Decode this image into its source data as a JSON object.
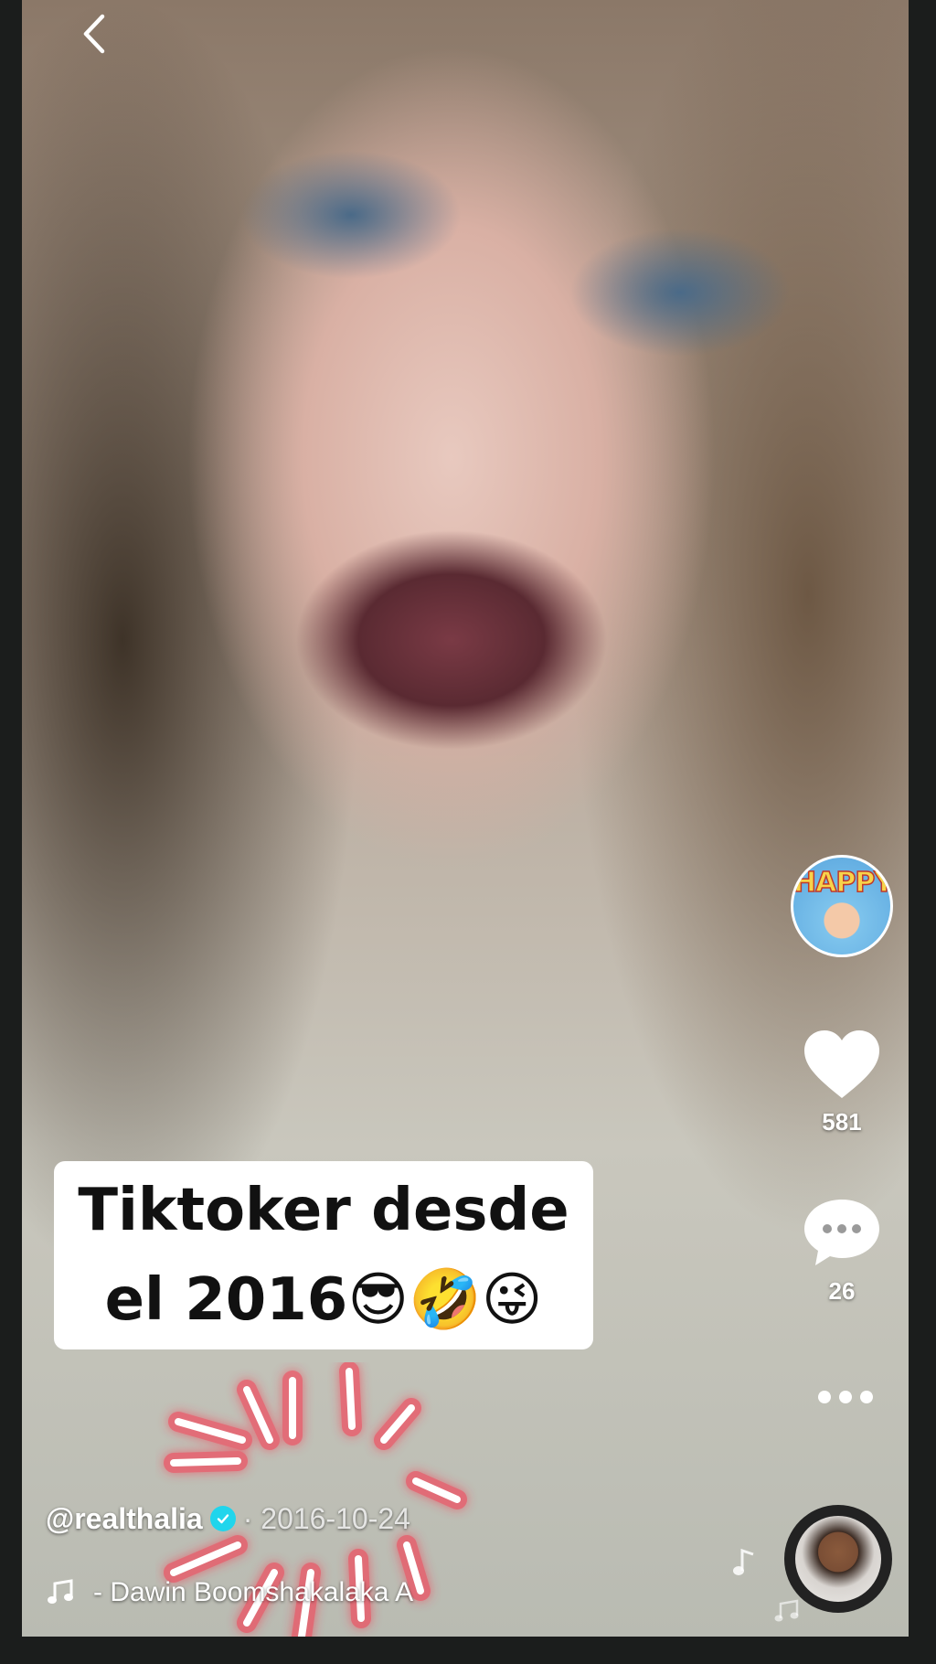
{
  "sticker_avatar": {
    "text": "HAPPY"
  },
  "actions": {
    "likes": "581",
    "comments": "26"
  },
  "caption": {
    "line1": "Tiktoker desde",
    "line2": "el 2016😎🤣😜"
  },
  "author": {
    "handle": "@realthalia",
    "date": "· 2016-10-24"
  },
  "music": {
    "title": "- Dawin    Boomshakalaka A"
  },
  "icons": {
    "back": "chevron-left-icon",
    "like": "heart-icon",
    "comment": "comment-bubble-icon",
    "more": "more-dots-icon",
    "verified": "verified-check-icon",
    "music": "music-note-icon"
  },
  "colors": {
    "verified": "#20d5ec",
    "burst": "#ff2a44"
  }
}
